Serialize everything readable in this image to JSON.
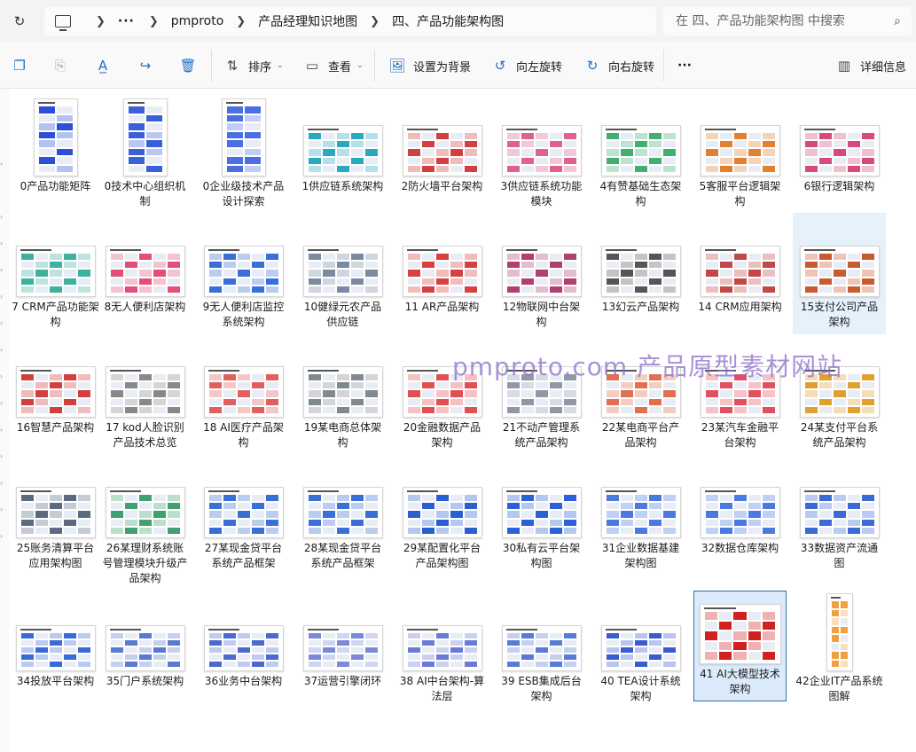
{
  "address": {
    "crumbs": [
      "pmproto",
      "产品经理知识地图",
      "四、产品功能架构图"
    ],
    "search_placeholder": "在 四、产品功能架构图 中搜索"
  },
  "toolbar": {
    "sort": "排序",
    "view": "查看",
    "set_bg": "设置为背景",
    "rotate_left": "向左旋转",
    "rotate_right": "向右旋转",
    "more": "···",
    "details": "详细信息"
  },
  "watermark": "pmproto.com 产品原型素材网站",
  "files": [
    {
      "label": "0产品功能矩阵",
      "shape": "tall",
      "theme": "#2b4fd8"
    },
    {
      "label": "0技术中心组织机制",
      "shape": "tall",
      "theme": "#3a5fd8"
    },
    {
      "label": "0企业级技术产品设计探索",
      "shape": "tall",
      "theme": "#4a6fe0"
    },
    {
      "label": "1供应链系统架构",
      "shape": "wide",
      "theme": "#2aa8c0"
    },
    {
      "label": "2防火墙平台架构",
      "shape": "wide",
      "theme": "#d04040"
    },
    {
      "label": "3供应链系统功能模块",
      "shape": "wide",
      "theme": "#e06090"
    },
    {
      "label": "4有赞基础生态架构",
      "shape": "wide",
      "theme": "#40b070"
    },
    {
      "label": "5客服平台逻辑架构",
      "shape": "wide",
      "theme": "#e08030"
    },
    {
      "label": "6银行逻辑架构",
      "shape": "wide",
      "theme": "#d84a7a"
    },
    {
      "label": "7 CRM产品功能架构",
      "shape": "wide",
      "theme": "#40b0a0"
    },
    {
      "label": "8无人便利店架构",
      "shape": "wide",
      "theme": "#e0507a"
    },
    {
      "label": "9无人便利店监控系统架构",
      "shape": "wide",
      "theme": "#3a6fd8"
    },
    {
      "label": "10健绿元农产品供应链",
      "shape": "wide",
      "theme": "#7a8aa0"
    },
    {
      "label": "11 AR产品架构",
      "shape": "wide",
      "theme": "#d84040"
    },
    {
      "label": "12物联网中台架构",
      "shape": "wide",
      "theme": "#b04070"
    },
    {
      "label": "13幻云产品架构",
      "shape": "wide",
      "theme": "#555555"
    },
    {
      "label": "14 CRM应用架构",
      "shape": "wide",
      "theme": "#c04848"
    },
    {
      "label": "15支付公司产品架构",
      "shape": "wide",
      "theme": "#c85a30"
    },
    {
      "label": "16智慧产品架构",
      "shape": "wide",
      "theme": "#d04040"
    },
    {
      "label": "17 kod人脸识别产品技术总览",
      "shape": "wide",
      "theme": "#888888"
    },
    {
      "label": "18 AI医疗产品架构",
      "shape": "wide",
      "theme": "#e06060"
    },
    {
      "label": "19某电商总体架构",
      "shape": "wide",
      "theme": "#808890"
    },
    {
      "label": "20金融数据产品架构",
      "shape": "wide",
      "theme": "#e05050"
    },
    {
      "label": "21不动产管理系统产品架构",
      "shape": "wide",
      "theme": "#9098a8"
    },
    {
      "label": "22某电商平台产品架构",
      "shape": "wide",
      "theme": "#e07050"
    },
    {
      "label": "23某汽车金融平台架构",
      "shape": "wide",
      "theme": "#e05060"
    },
    {
      "label": "24某支付平台系统产品架构",
      "shape": "wide",
      "theme": "#e0a030"
    },
    {
      "label": "25账务清算平台应用架构图",
      "shape": "wide",
      "theme": "#5a6a80"
    },
    {
      "label": "26某理财系统账号管理模块升级产品架构",
      "shape": "wide",
      "theme": "#40a070"
    },
    {
      "label": "27某现金贷平台系统产品框架",
      "shape": "wide",
      "theme": "#3a6fd8"
    },
    {
      "label": "28某现金贷平台系统产品框架",
      "shape": "wide",
      "theme": "#3a6fd8"
    },
    {
      "label": "29某配置化平台产品架构图",
      "shape": "wide",
      "theme": "#2a5fd0"
    },
    {
      "label": "30私有云平台架构图",
      "shape": "wide",
      "theme": "#2a60d8"
    },
    {
      "label": "31企业数据基建架构图",
      "shape": "wide",
      "theme": "#4a7ae0"
    },
    {
      "label": "32数据仓库架构",
      "shape": "wide",
      "theme": "#4a7ae0"
    },
    {
      "label": "33数据资产流通图",
      "shape": "wide",
      "theme": "#3a6ad8"
    },
    {
      "label": "34投放平台架构",
      "shape": "wide",
      "theme": "#3a6ad8"
    },
    {
      "label": "35门户系统架构",
      "shape": "wide",
      "theme": "#5a7ad0"
    },
    {
      "label": "36业务中台架构",
      "shape": "wide",
      "theme": "#4a6ad0"
    },
    {
      "label": "37运营引擎闭环",
      "shape": "wide",
      "theme": "#7a8ad8"
    },
    {
      "label": "38 AI中台架构-算法层",
      "shape": "wide",
      "theme": "#6a7ad8"
    },
    {
      "label": "39 ESB集成后台架构",
      "shape": "wide",
      "theme": "#5a7ad8"
    },
    {
      "label": "40 TEA设计系统架构",
      "shape": "wide",
      "theme": "#3a5ad0"
    },
    {
      "label": "41 AI大模型技术架构",
      "shape": "wide",
      "theme": "#d02020"
    },
    {
      "label": "42企业IT产品系统图解",
      "shape": "tallnarrow",
      "theme": "#f0a040"
    }
  ]
}
